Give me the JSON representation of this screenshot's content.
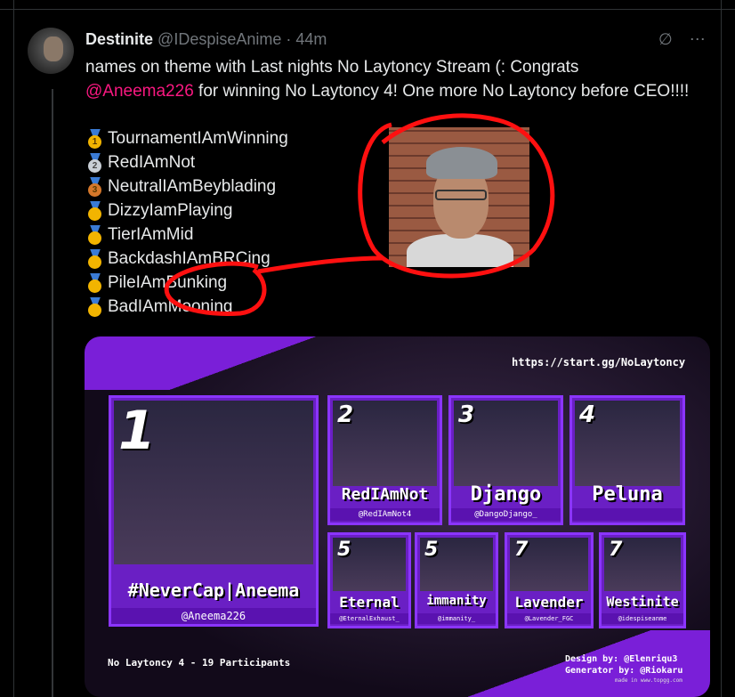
{
  "tweet": {
    "author_name": "Destinite",
    "author_handle": "@IDespiseAnime",
    "separator": "·",
    "time": "44m",
    "more_icon": "⋯",
    "grok_icon": "∅",
    "text_before": "names on theme with Last nights No Laytoncy Stream (:  Congrats ",
    "mention": "@Aneema226",
    "text_after": " for winning No Laytoncy 4! One more No Laytoncy before CEO!!!!",
    "results": [
      {
        "medal": "1",
        "medal_type": "gold",
        "name": "TournamentIAmWinning"
      },
      {
        "medal": "2",
        "medal_type": "silver",
        "name": "RedIAmNot"
      },
      {
        "medal": "3",
        "medal_type": "bronze",
        "name": "NeutralIAmBeyblading"
      },
      {
        "medal": "",
        "medal_type": "gold",
        "name": "DizzyIamPlaying"
      },
      {
        "medal": "",
        "medal_type": "gold",
        "name": "TierIAmMid"
      },
      {
        "medal": "",
        "medal_type": "gold",
        "name": "BackdashIAmBRCing"
      },
      {
        "medal": "",
        "medal_type": "gold",
        "name": "PileIAmBunking"
      },
      {
        "medal": "",
        "medal_type": "gold",
        "name": "BadIAmMooning"
      }
    ]
  },
  "graphic": {
    "url": "https://start.gg/NoLaytoncy",
    "footer_left": "No Laytoncy 4 - 19 Participants",
    "credit_design": "Design by:  @Elenriqu3",
    "credit_generator": "Generator by: @Riokaru",
    "made_in": "made in www.topgg.com",
    "players": [
      {
        "rank": "1",
        "name": "#NeverCap|Aneema",
        "handle": "@Aneema226"
      },
      {
        "rank": "2",
        "name": "RedIAmNot",
        "handle": "@RedIAmNot4"
      },
      {
        "rank": "3",
        "name": "Django",
        "handle": "@DangoDjango_"
      },
      {
        "rank": "4",
        "name": "Peluna",
        "handle": ""
      },
      {
        "rank": "5",
        "name": "Eternal",
        "handle": "@EternalExhaust_"
      },
      {
        "rank": "5",
        "name": "immanity",
        "handle": "@immanity_"
      },
      {
        "rank": "7",
        "name": "Lavender",
        "handle": "@Lavender_FGC"
      },
      {
        "rank": "7",
        "name": "Westinite",
        "handle": "@idespiseanme"
      }
    ]
  },
  "colors": {
    "accent_pink": "#f91880",
    "scribble_red": "#ff1010",
    "brand_purple": "#7a1fd8"
  }
}
